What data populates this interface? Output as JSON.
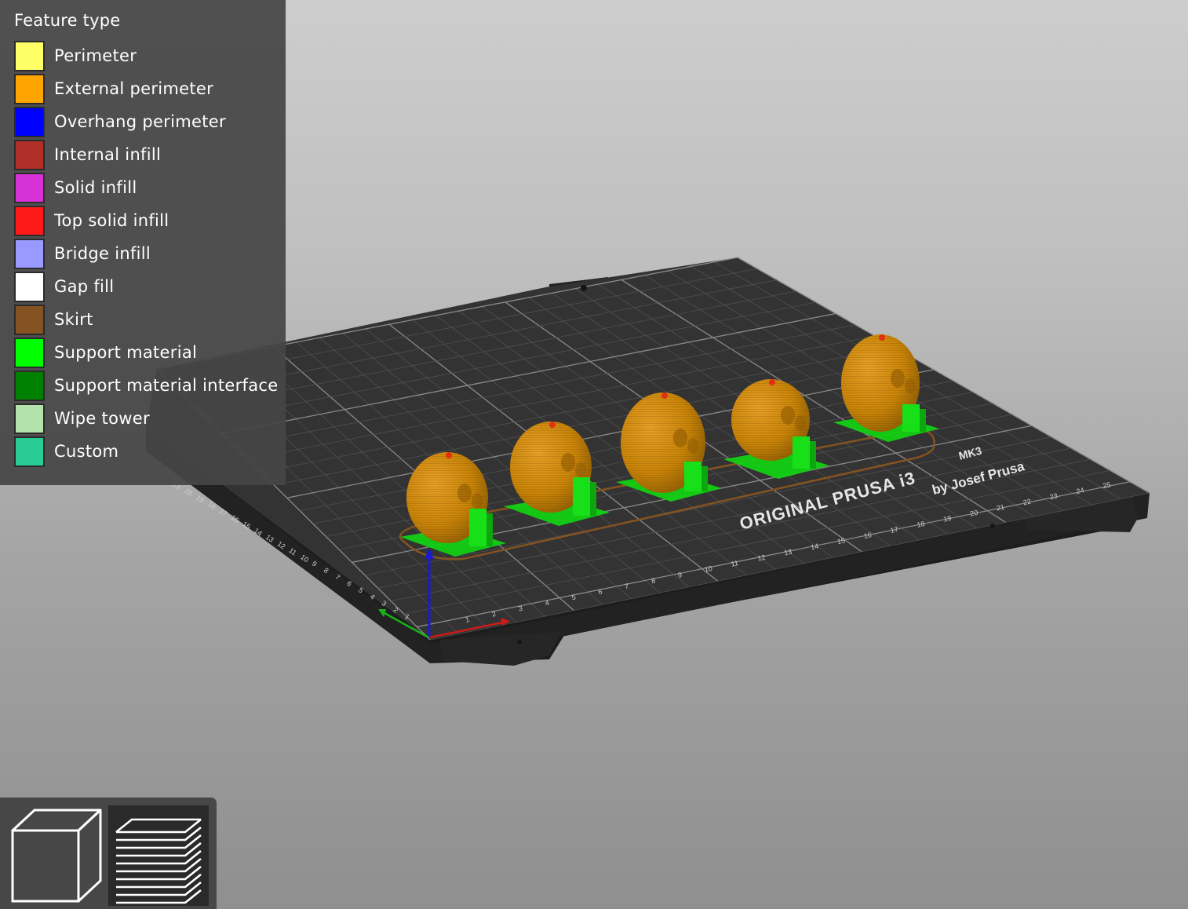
{
  "legend": {
    "title": "Feature type",
    "items": [
      {
        "label": "Perimeter",
        "color": "#ffff66"
      },
      {
        "label": "External perimeter",
        "color": "#ffa500"
      },
      {
        "label": "Overhang perimeter",
        "color": "#0000ff"
      },
      {
        "label": "Internal infill",
        "color": "#b03029"
      },
      {
        "label": "Solid infill",
        "color": "#d732d7"
      },
      {
        "label": "Top solid infill",
        "color": "#ff1a1a"
      },
      {
        "label": "Bridge infill",
        "color": "#9999ff"
      },
      {
        "label": "Gap fill",
        "color": "#ffffff"
      },
      {
        "label": "Skirt",
        "color": "#845321"
      },
      {
        "label": "Support material",
        "color": "#00ff00"
      },
      {
        "label": "Support material interface",
        "color": "#008000"
      },
      {
        "label": "Wipe tower",
        "color": "#b3e3ab"
      },
      {
        "label": "Custom",
        "color": "#28cc94"
      }
    ]
  },
  "bed": {
    "brand_line": "ORIGINAL PRUSA i3",
    "model": "MK3",
    "byline": "by Josef Prusa",
    "front_ticks": [
      "1",
      "2",
      "3",
      "4",
      "5",
      "6",
      "7",
      "8",
      "9",
      "10",
      "11",
      "12",
      "13",
      "14",
      "15",
      "16",
      "17",
      "18",
      "19",
      "20",
      "21",
      "22",
      "23",
      "24",
      "25"
    ],
    "side_ticks": [
      "1",
      "2",
      "3",
      "4",
      "5",
      "6",
      "7",
      "8",
      "9",
      "10",
      "11",
      "12",
      "13",
      "14",
      "15",
      "16",
      "17",
      "18",
      "19",
      "20",
      "21"
    ]
  },
  "colors": {
    "model": "#d08a0c",
    "support": "#18e018",
    "skirt": "#845321",
    "axis_x": "#d42020",
    "axis_y": "#20c020",
    "axis_z": "#2020d0"
  },
  "toolbar": {
    "buttons": [
      {
        "name": "3d-view",
        "icon": "cube-icon"
      },
      {
        "name": "layers-view",
        "icon": "layers-icon"
      }
    ]
  }
}
